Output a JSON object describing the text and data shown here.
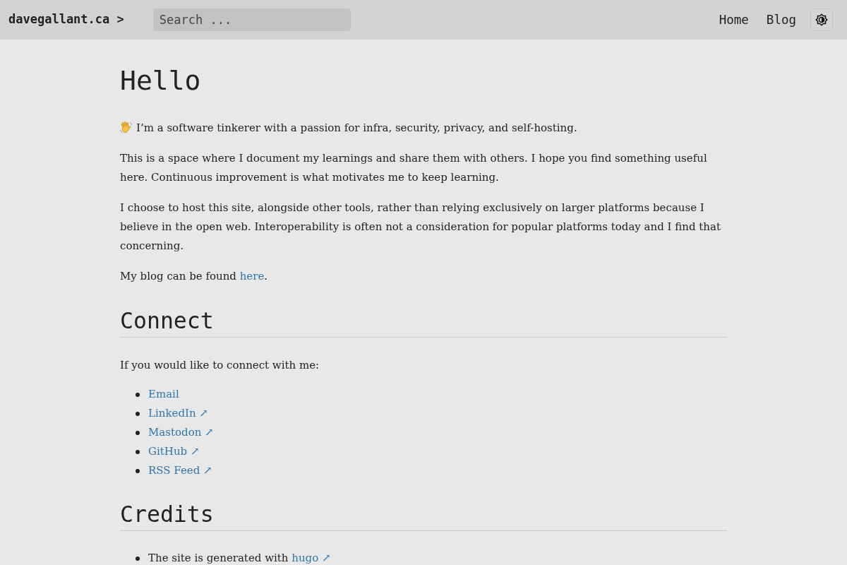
{
  "header": {
    "logo": "davegallant.ca >",
    "search": {
      "placeholder": "Search ..."
    },
    "nav": [
      {
        "label": "Home"
      },
      {
        "label": "Blog"
      }
    ]
  },
  "intro": {
    "title": "Hello",
    "paragraphs": [
      {
        "kind": "greeting",
        "segments": [
          {
            "text": "I’m a software tinkerer with a passion for infra, security, privacy, and self-hosting."
          }
        ]
      },
      {
        "kind": "plain",
        "segments": [
          {
            "text": "This is a space where I document my learnings and share them with others. I hope you find something useful here. Continuous improvement is what motivates me to keep learning."
          }
        ]
      },
      {
        "kind": "plain",
        "segments": [
          {
            "text": "I choose to host this site, alongside other tools, rather than relying exclusively on larger platforms because I believe in the open web. Interoperability is often not a consideration for popular platforms today and I find that concerning."
          }
        ]
      },
      {
        "kind": "plain",
        "segments": [
          {
            "text": "My blog can be found "
          },
          {
            "link": "here"
          },
          {
            "text": "."
          }
        ]
      }
    ]
  },
  "sections": [
    {
      "heading": "Connect",
      "intro": "If you would like to connect with me:",
      "items": [
        {
          "segments": [
            {
              "link": "Email"
            }
          ]
        },
        {
          "segments": [
            {
              "link": "LinkedIn ↗"
            }
          ]
        },
        {
          "segments": [
            {
              "link": "Mastodon ↗"
            }
          ]
        },
        {
          "segments": [
            {
              "link": "GitHub ↗"
            }
          ]
        },
        {
          "segments": [
            {
              "link": "RSS Feed ↗"
            }
          ]
        }
      ]
    },
    {
      "heading": "Credits",
      "items": [
        {
          "segments": [
            {
              "text": "The site is generated with "
            },
            {
              "link": "hugo ↗"
            }
          ]
        }
      ]
    }
  ]
}
